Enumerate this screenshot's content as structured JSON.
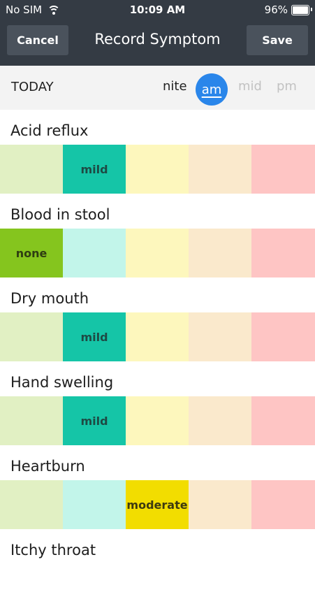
{
  "status_bar": {
    "carrier": "No SIM",
    "time": "10:09 AM",
    "battery": "96%"
  },
  "nav": {
    "cancel_label": "Cancel",
    "title": "Record Symptom",
    "save_label": "Save"
  },
  "time_of_day": {
    "today_label": "TODAY",
    "options": [
      "nite",
      "am",
      "mid",
      "pm"
    ],
    "selected": "am"
  },
  "colors": {
    "header": "#343b44",
    "nav_button": "#4a525c",
    "selected_time": "#2a86ea",
    "none_light": "#e1f0c3",
    "none_active": "#85c51e",
    "mild_light": "#c2f5ea",
    "mild_active": "#15c5a7",
    "moderate_light": "#fdf7bd",
    "moderate_active": "#f2dd00",
    "severe_light": "#fae9cc",
    "extreme_light": "#fec5c4"
  },
  "symptoms": [
    {
      "name": "Acid reflux",
      "selected_label": "mild"
    },
    {
      "name": "Blood in stool",
      "selected_label": "none"
    },
    {
      "name": "Dry mouth",
      "selected_label": "mild"
    },
    {
      "name": "Hand swelling",
      "selected_label": "mild"
    },
    {
      "name": "Heartburn",
      "selected_label": "moderate"
    },
    {
      "name": "Itchy throat"
    }
  ]
}
